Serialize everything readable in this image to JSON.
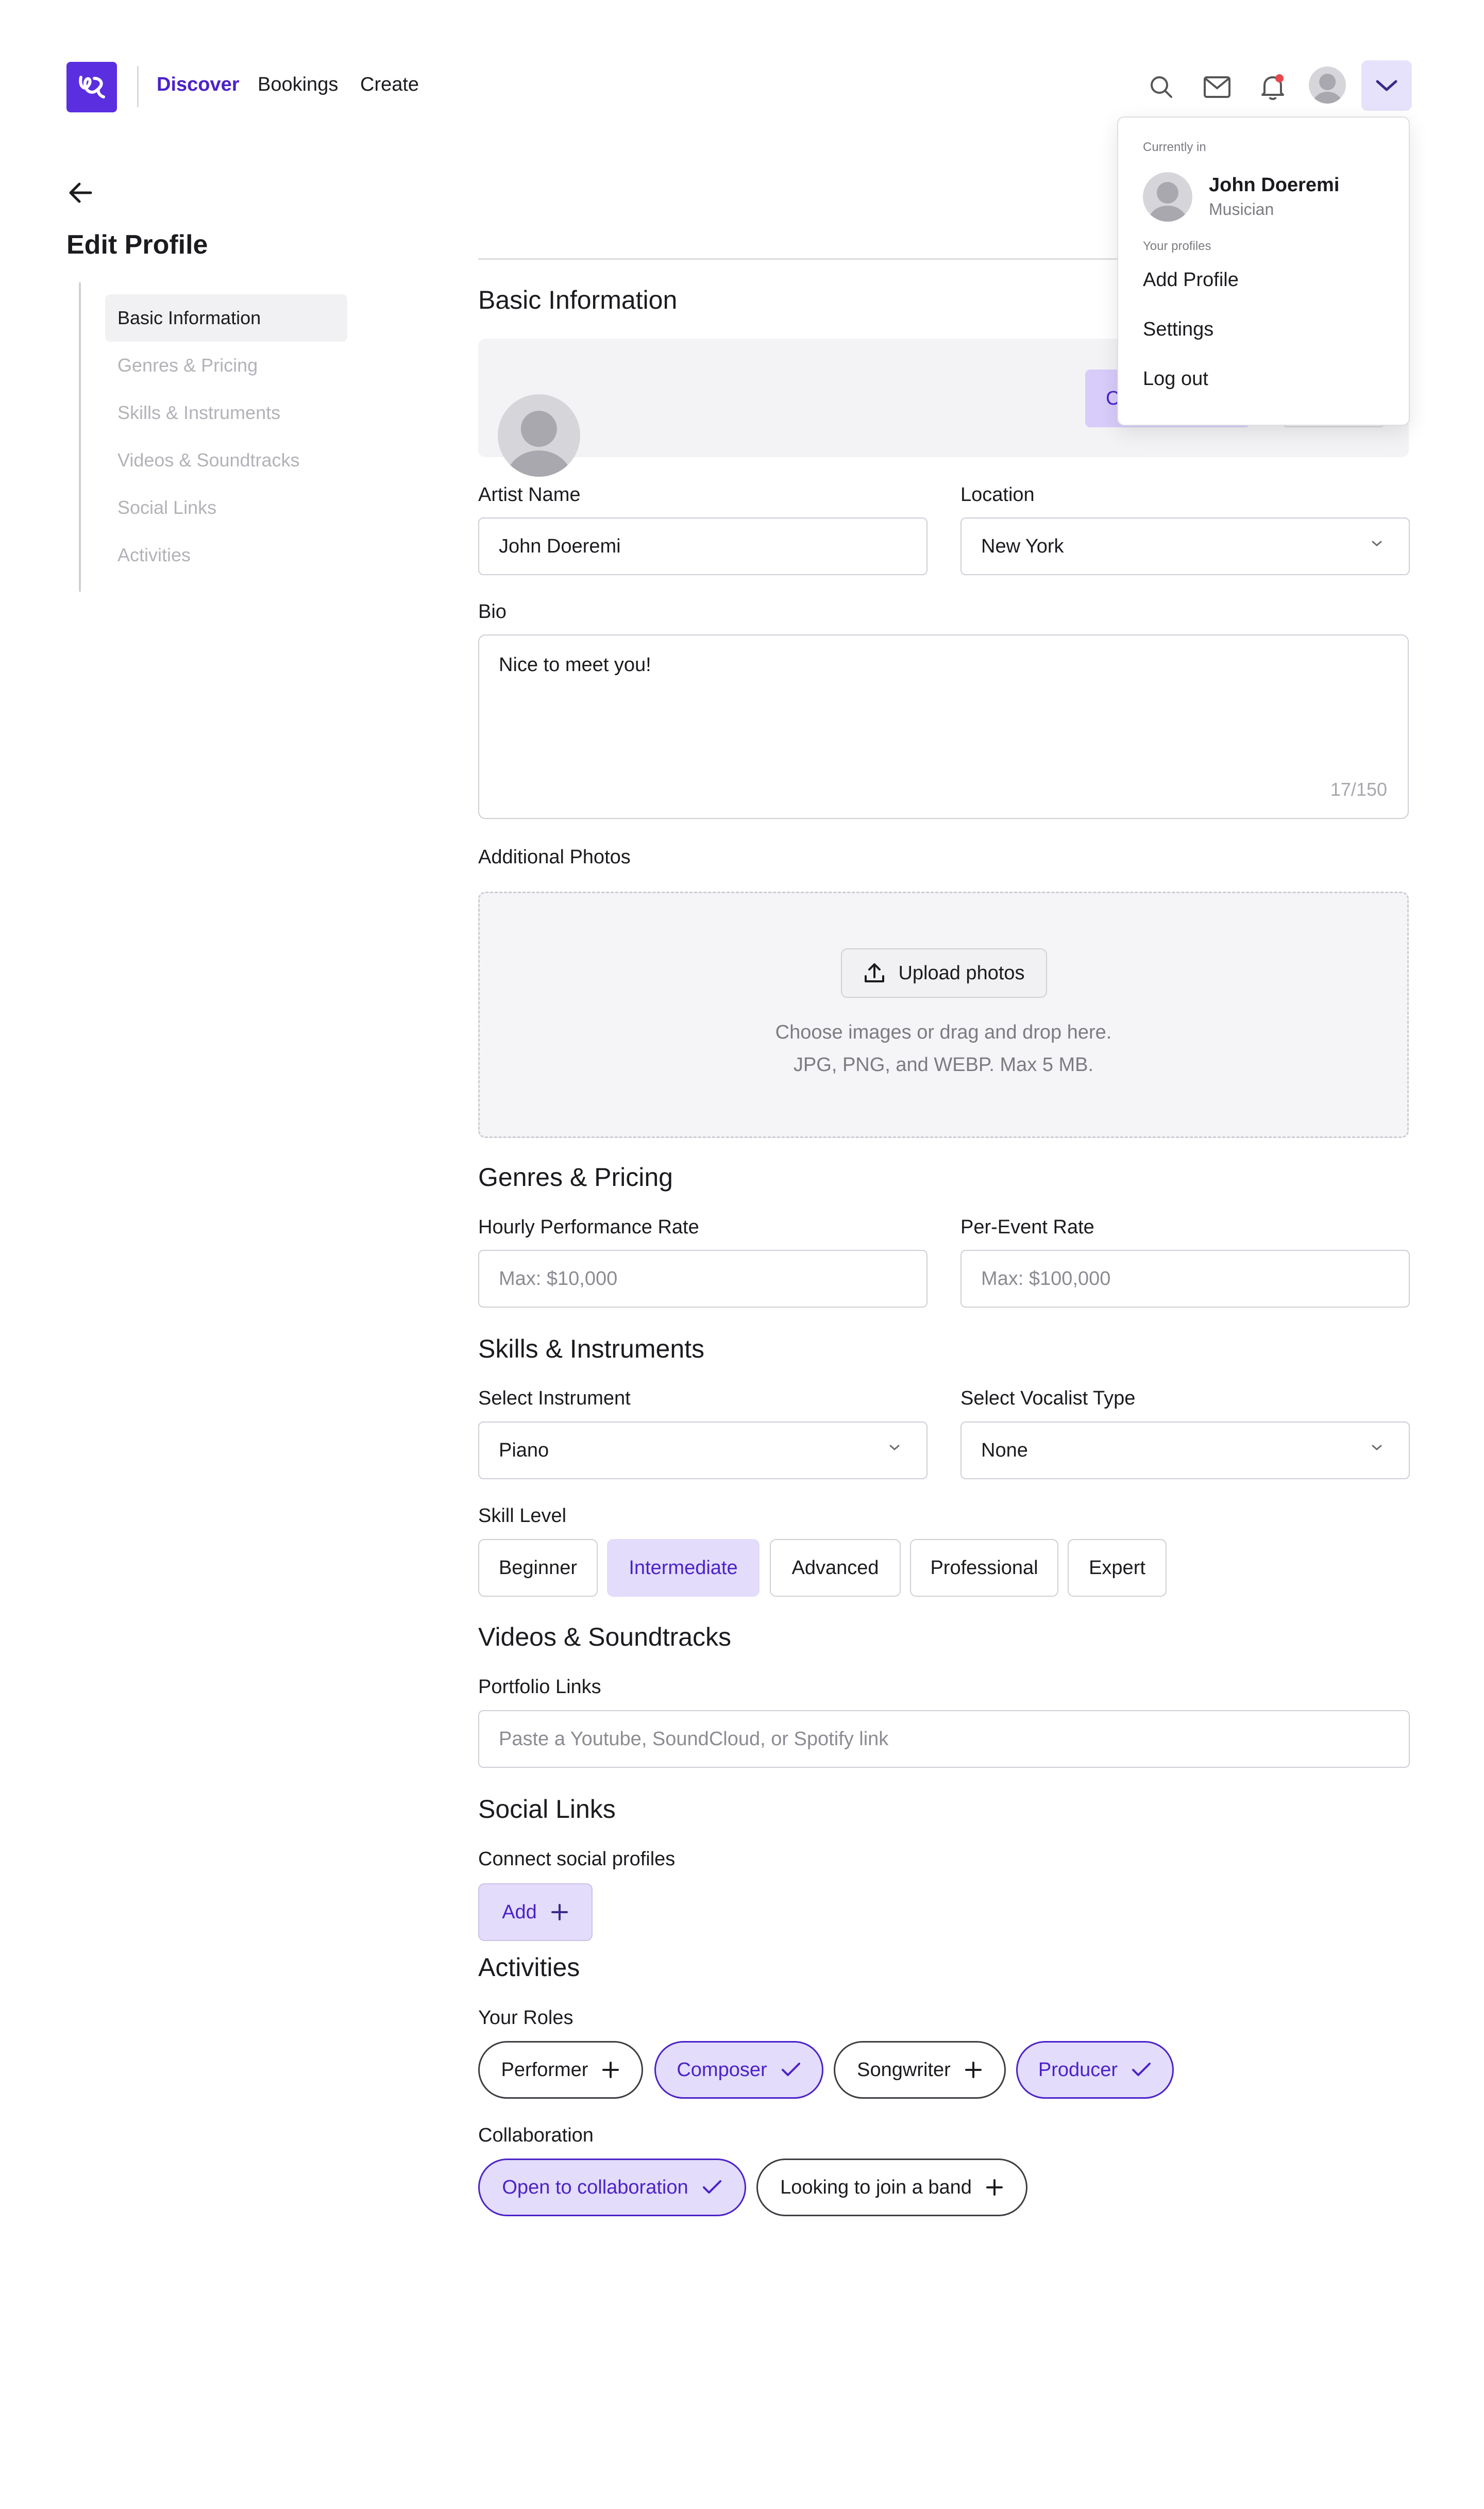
{
  "nav": {
    "logo_label": "logo",
    "links": [
      "Discover",
      "Bookings",
      "Create"
    ],
    "active": "Discover",
    "icons": [
      "search-icon",
      "mail-icon",
      "bell-icon",
      "avatar",
      "chevron-down-icon"
    ],
    "accent": "#5b2ee0"
  },
  "sidebar": {
    "title": "Edit Profile",
    "items": [
      {
        "label": "Basic Information",
        "active": true
      },
      {
        "label": "Genres & Pricing",
        "active": false
      },
      {
        "label": "Skills & Instruments",
        "active": false
      },
      {
        "label": "Videos & Soundtracks",
        "active": false
      },
      {
        "label": "Social Links",
        "active": false
      },
      {
        "label": "Activities",
        "active": false
      }
    ]
  },
  "basic": {
    "title": "Basic Information",
    "photo_primary_label": "C",
    "artist_name_label": "Artist Name",
    "artist_name_value": "John Doeremi",
    "location_label": "Location",
    "location_value": "New York",
    "bio_label": "Bio",
    "bio_value": "Nice to meet you!",
    "bio_counter": "17/150",
    "photos_label": "Additional Photos",
    "upload_button": "Upload photos",
    "upload_hint_1": "Choose images or drag and drop here.",
    "upload_hint_2": "JPG, PNG, and WEBP. Max 5 MB."
  },
  "genres": {
    "title": "Genres & Pricing",
    "hourly_label": "Hourly Performance Rate",
    "hourly_placeholder": "Max: $10,000",
    "event_label": "Per-Event Rate",
    "event_placeholder": "Max: $100,000"
  },
  "skills": {
    "title": "Skills & Instruments",
    "instrument_label": "Select Instrument",
    "instrument_value": "Piano",
    "vocalist_label": "Select Vocalist Type",
    "vocalist_value": "None",
    "level_label": "Skill Level",
    "levels": [
      "Beginner",
      "Intermediate",
      "Advanced",
      "Professional",
      "Expert"
    ],
    "selected_level": "Intermediate"
  },
  "videos": {
    "title": "Videos & Soundtracks",
    "portfolio_label": "Portfolio Links",
    "portfolio_placeholder": "Paste a Youtube, SoundCloud, or Spotify link"
  },
  "social": {
    "title": "Social Links",
    "connect_label": "Connect social profiles",
    "add_button": "Add"
  },
  "activities": {
    "title": "Activities",
    "roles_label": "Your Roles",
    "roles": [
      {
        "label": "Performer",
        "selected": false
      },
      {
        "label": "Composer",
        "selected": true
      },
      {
        "label": "Songwriter",
        "selected": false
      },
      {
        "label": "Producer",
        "selected": true
      }
    ],
    "collab_label": "Collaboration",
    "collab": [
      {
        "label": "Open to collaboration",
        "selected": true
      },
      {
        "label": "Looking to join a band",
        "selected": false
      }
    ]
  },
  "dropdown": {
    "currently_in": "Currently in",
    "user_name": "John Doeremi",
    "user_role": "Musician",
    "profiles_caption": "Your profiles",
    "items": [
      "Add Profile",
      "Settings",
      "Log out"
    ]
  }
}
